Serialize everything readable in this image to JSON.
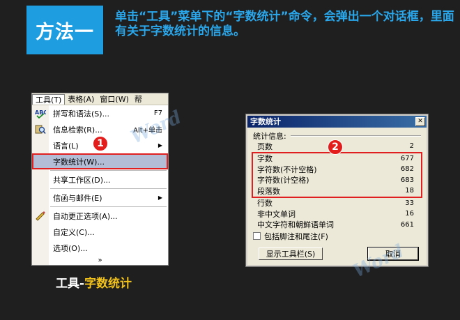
{
  "header": {
    "badge": "方法一",
    "text": "单击“工具”菜单下的“字数统计”命令，会弹出一个对话框，里面有关于字数统计的信息。"
  },
  "menubar": {
    "items": [
      "工具(T)",
      "表格(A)",
      "窗口(W)",
      "帮"
    ]
  },
  "menu": {
    "items": [
      {
        "label": "拼写和语法(S)...",
        "shortcut": "F7",
        "icon": "spellcheck-icon"
      },
      {
        "label": "信息检索(R)...",
        "shortcut": "Alt+单击",
        "icon": "research-icon"
      },
      {
        "label": "语言(L)",
        "submenu": true
      },
      {
        "label": "字数统计(W)...",
        "highlighted": true
      },
      {
        "label": "共享工作区(D)..."
      },
      {
        "label": "信函与邮件(E)",
        "submenu": true
      },
      {
        "label": "自动更正选项(A)...",
        "icon": "autocorrect-icon"
      },
      {
        "label": "自定义(C)..."
      },
      {
        "label": "选项(O)..."
      }
    ],
    "more": "»"
  },
  "caption": {
    "part1": "工具",
    "sep": "-",
    "part2": "字数统计"
  },
  "markers": {
    "one": "1",
    "two": "2"
  },
  "dialog": {
    "title": "字数统计",
    "group_label": "统计信息:",
    "stats": [
      {
        "name": "页数",
        "value": "2"
      },
      {
        "name": "字数",
        "value": "677"
      },
      {
        "name": "字符数(不计空格)",
        "value": "682"
      },
      {
        "name": "字符数(计空格)",
        "value": "683"
      },
      {
        "name": "段落数",
        "value": "18"
      },
      {
        "name": "行数",
        "value": "33"
      },
      {
        "name": "非中文单词",
        "value": "16"
      },
      {
        "name": "中文字符和朝鲜语单词",
        "value": "661"
      }
    ],
    "checkbox_label": "包括脚注和尾注(F)",
    "show_toolbar_button": "显示工具栏(S)",
    "cancel_button": "取消"
  },
  "watermark": "Word"
}
